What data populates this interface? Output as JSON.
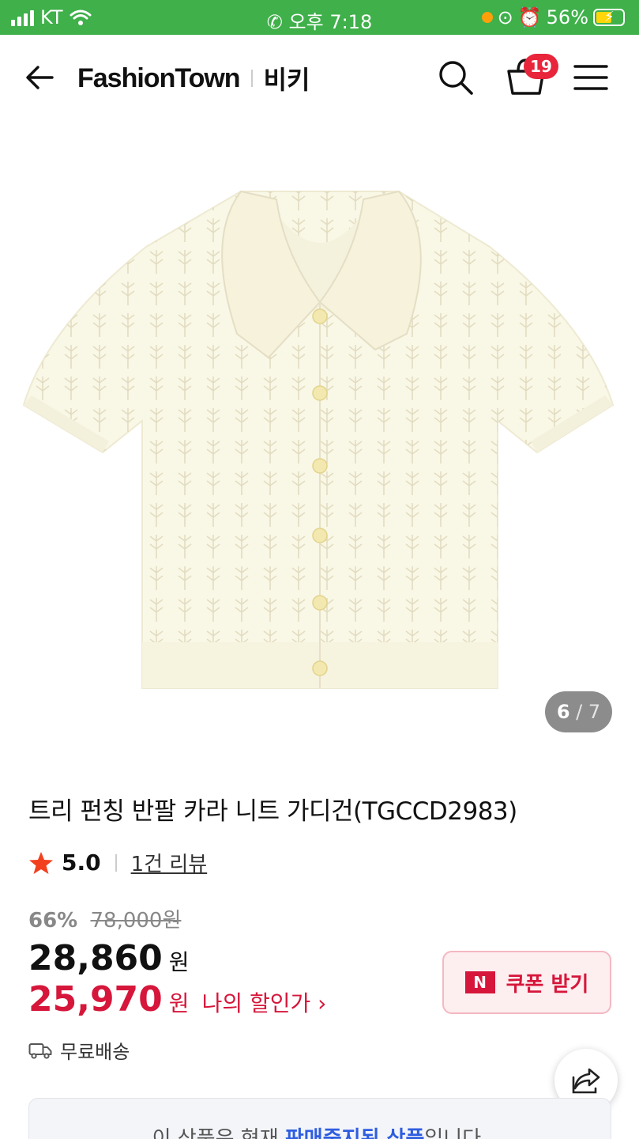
{
  "status_bar": {
    "carrier": "KT",
    "time": "오후 7:18",
    "battery": "56%"
  },
  "header": {
    "brand": "FashionTown",
    "shop": "비키",
    "cart_count": "19"
  },
  "gallery": {
    "current": "6",
    "separator": "/",
    "total": "7"
  },
  "product": {
    "title": "트리 펀칭 반팔 카라 니트 가디건(TGCCD2983)",
    "rating": "5.0",
    "reviews": "1건 리뷰",
    "discount_percent": "66%",
    "original_price": "78,000원",
    "price": "28,860",
    "currency": "원",
    "my_price": "25,970",
    "my_price_label": "나의 할인가 ›",
    "shipping": "무료배송"
  },
  "coupon": {
    "badge": "N",
    "label": "쿠폰 받기"
  },
  "notice": {
    "prefix": "이 상품은 현재 ",
    "highlight": "판매중지된 상품",
    "suffix": "입니다."
  },
  "colors": {
    "status_bar": "#3fb04a",
    "accent_red": "#d6163a",
    "badge_red": "#e8253b",
    "link_blue": "#2f5de0"
  }
}
